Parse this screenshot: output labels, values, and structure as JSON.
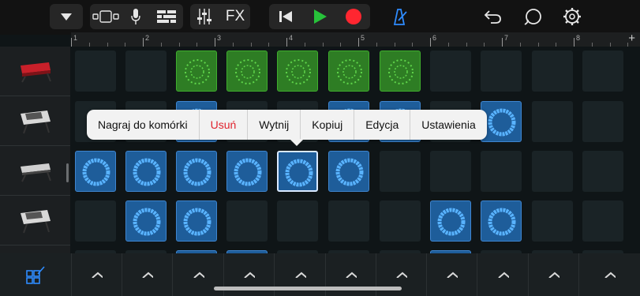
{
  "toolbar": {
    "fx_label": "FX",
    "items": [
      "menu-dropdown-icon",
      "browser-view-icon",
      "microphone-icon",
      "tracks-view-icon",
      "mixer-icon",
      "fx-button",
      "rewind-icon",
      "play-icon",
      "record-icon",
      "metronome-icon",
      "undo-icon",
      "loop-browser-icon",
      "settings-gear-icon"
    ],
    "colors": {
      "play": "#27c23a",
      "record": "#ff2630",
      "metronome": "#2f8cff"
    }
  },
  "ruler": {
    "bars": [
      "1",
      "2",
      "3",
      "4",
      "5",
      "6",
      "7",
      "8"
    ],
    "add_label": "+"
  },
  "context_menu": {
    "items": [
      {
        "label": "Nagraj do komórki",
        "danger": false
      },
      {
        "label": "Usuń",
        "danger": true
      },
      {
        "label": "Wytnij",
        "danger": false
      },
      {
        "label": "Kopiuj",
        "danger": false
      },
      {
        "label": "Edycja",
        "danger": false
      },
      {
        "label": "Ustawienia",
        "danger": false
      }
    ]
  },
  "tracks": [
    {
      "name": "keyboard-synth-red-icon"
    },
    {
      "name": "drum-machine-icon"
    },
    {
      "name": "keyboard-synth-white-icon"
    },
    {
      "name": "drum-machine-icon"
    }
  ],
  "cell_colors": {
    "green": "#2e7d24",
    "blue": "#1e5d9a",
    "empty": "#1a2326"
  }
}
